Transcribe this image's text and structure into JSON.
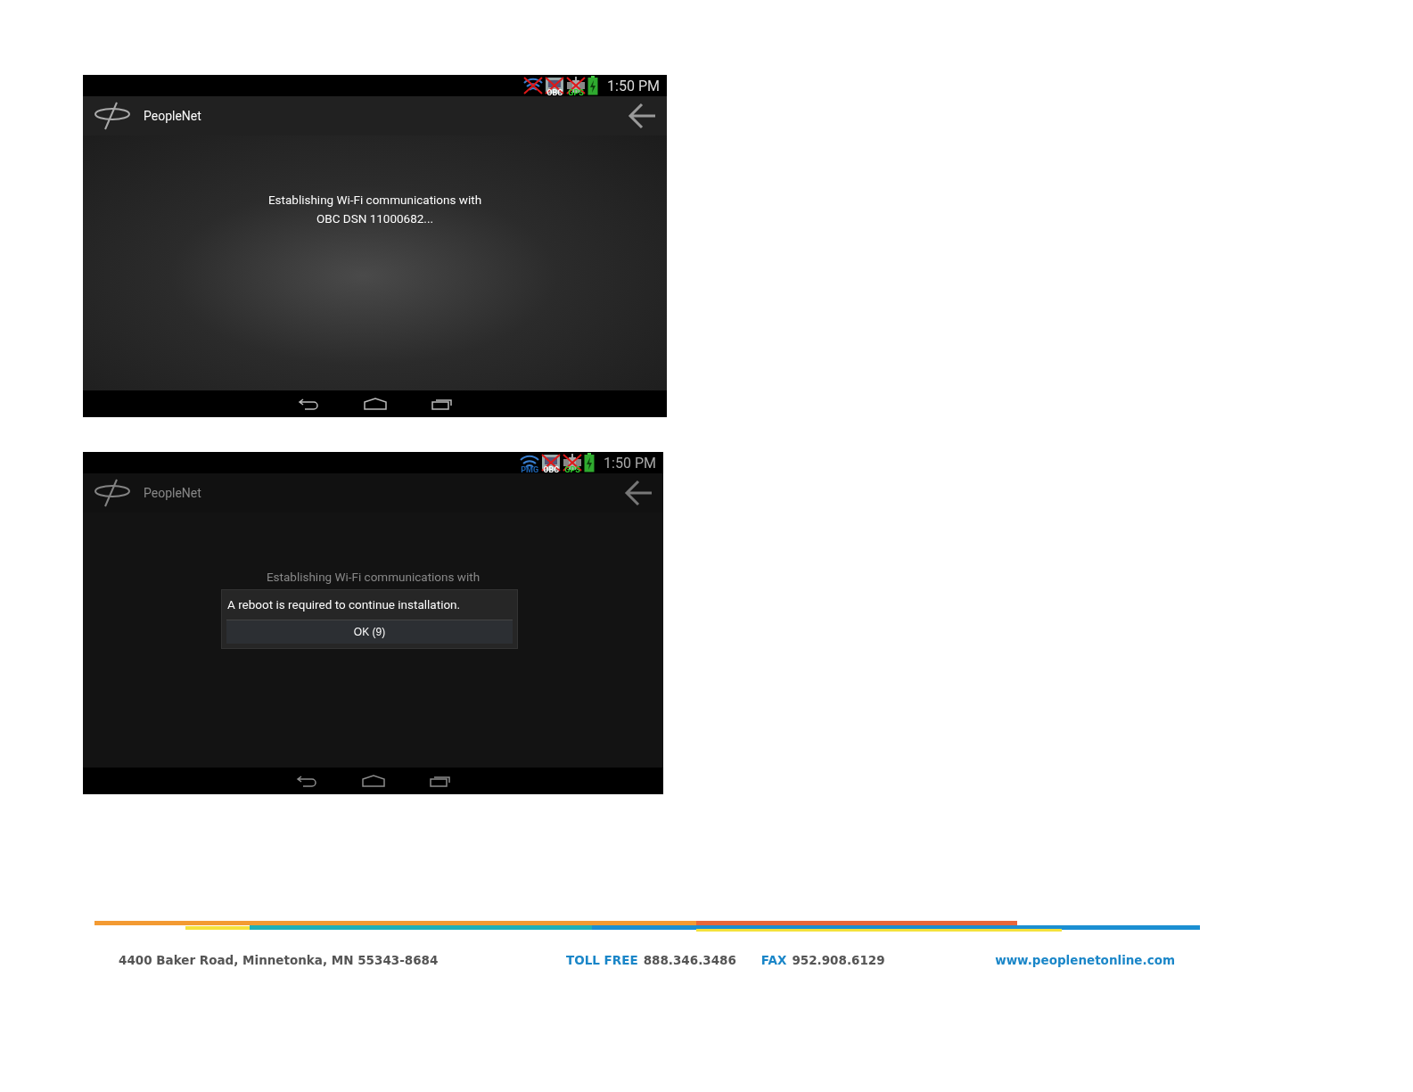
{
  "screens": [
    {
      "dimmed": false,
      "status_bar": {
        "icons": [
          {
            "kind": "wifi",
            "crossed": true
          },
          {
            "kind": "obc",
            "label": "OBC",
            "crossed": true
          },
          {
            "kind": "gps",
            "label": "GPS",
            "crossed": true
          },
          {
            "kind": "battery"
          }
        ],
        "time": "1:50 PM"
      },
      "app_bar": {
        "title": "PeopleNet"
      },
      "message": [
        "Establishing Wi-Fi communications with",
        "OBC DSN 11000682..."
      ]
    },
    {
      "dimmed": true,
      "status_bar": {
        "icons": [
          {
            "kind": "wifi",
            "label": "PMG",
            "crossed": false
          },
          {
            "kind": "obc",
            "label": "OBC",
            "crossed": true
          },
          {
            "kind": "gps",
            "label": "GPS",
            "crossed": true
          },
          {
            "kind": "battery"
          }
        ],
        "time": "1:50 PM"
      },
      "app_bar": {
        "title": "PeopleNet"
      },
      "message": [
        "Establishing Wi-Fi communications with"
      ],
      "dialog": {
        "text": "A reboot is required to continue installation.",
        "button": "OK (9)"
      }
    }
  ],
  "footer": {
    "address": "4400 Baker Road, Minnetonka, MN 55343-8684",
    "toll_free_label": "TOLL FREE",
    "toll_free": "888.346.3486",
    "fax_label": "FAX",
    "fax": "952.908.6129",
    "website": "www.peoplenetonline.com"
  }
}
